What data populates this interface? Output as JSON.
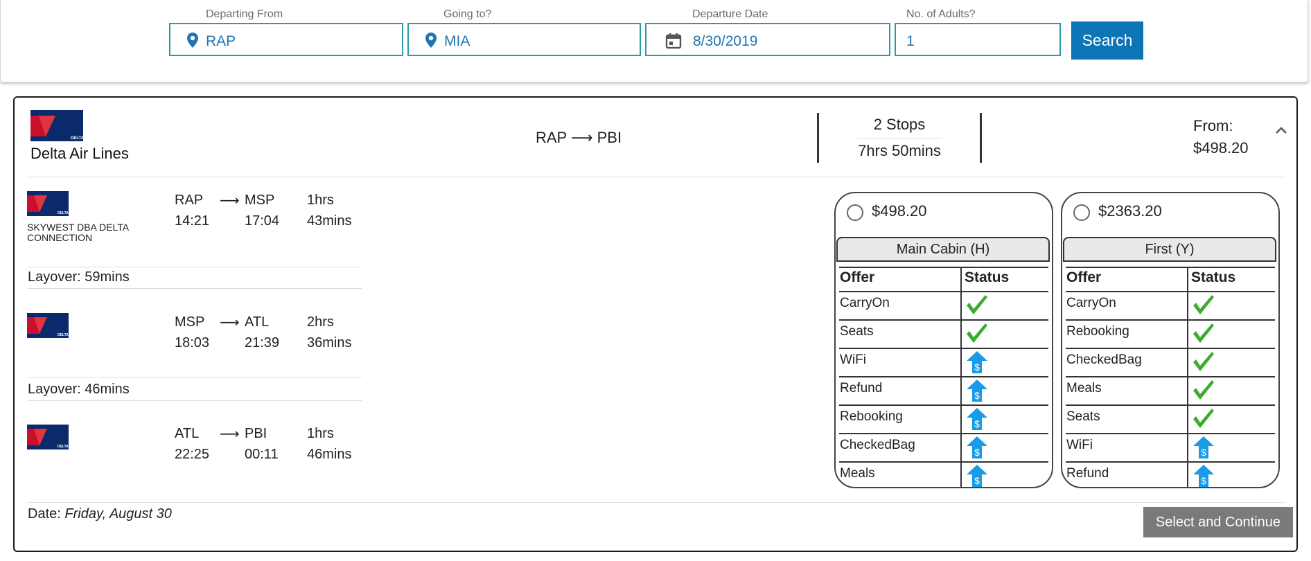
{
  "search": {
    "departing_label": "Departing From",
    "departing_value": "RAP",
    "going_label": "Going to?",
    "going_value": "MIA",
    "date_label": "Departure Date",
    "date_value": "8/30/2019",
    "adults_label": "No. of Adults?",
    "adults_value": "1",
    "search_button": "Search",
    "icons": [
      "location-pin-icon",
      "location-pin-icon",
      "calendar-icon"
    ]
  },
  "flight": {
    "airline": "Delta Air Lines",
    "route": "RAP ⟶ PBI",
    "stops": "2 Stops",
    "duration": "7hrs 50mins",
    "from_label": "From:",
    "from_price": "$498.20",
    "segments": [
      {
        "carrier": "SKYWEST DBA DELTA CONNECTION",
        "origin": "RAP",
        "arrow": "⟶",
        "destination": "MSP",
        "depart_time": "14:21",
        "arrive_time": "17:04",
        "dur_hrs": "1hrs",
        "dur_mins": "43mins"
      },
      {
        "carrier": "",
        "origin": "MSP",
        "arrow": "⟶",
        "destination": "ATL",
        "depart_time": "18:03",
        "arrive_time": "21:39",
        "dur_hrs": "2hrs",
        "dur_mins": "36mins"
      },
      {
        "carrier": "",
        "origin": "ATL",
        "arrow": "⟶",
        "destination": "PBI",
        "depart_time": "22:25",
        "arrive_time": "00:11",
        "dur_hrs": "1hrs",
        "dur_mins": "46mins"
      }
    ],
    "layovers": [
      "Layover: 59mins",
      "Layover: 46mins"
    ],
    "date_prefix": "Date:",
    "date_value": "Friday, August 30",
    "continue_button": "Select and Continue"
  },
  "fares": [
    {
      "price": "$498.20",
      "cabin": "Main Cabin  (H)",
      "offer_header": "Offer",
      "status_header": "Status",
      "offers": [
        {
          "name": "CarryOn",
          "status": "included"
        },
        {
          "name": "Seats",
          "status": "included"
        },
        {
          "name": "WiFi",
          "status": "paid-upgrade"
        },
        {
          "name": "Refund",
          "status": "paid-upgrade"
        },
        {
          "name": "Rebooking",
          "status": "paid-upgrade"
        },
        {
          "name": "CheckedBag",
          "status": "paid-upgrade"
        },
        {
          "name": "Meals",
          "status": "paid-upgrade"
        }
      ]
    },
    {
      "price": "$2363.20",
      "cabin": "First  (Y)",
      "offer_header": "Offer",
      "status_header": "Status",
      "offers": [
        {
          "name": "CarryOn",
          "status": "included"
        },
        {
          "name": "Rebooking",
          "status": "included"
        },
        {
          "name": "CheckedBag",
          "status": "included"
        },
        {
          "name": "Meals",
          "status": "included"
        },
        {
          "name": "Seats",
          "status": "included"
        },
        {
          "name": "WiFi",
          "status": "paid-upgrade"
        },
        {
          "name": "Refund",
          "status": "paid-upgrade"
        }
      ]
    }
  ],
  "colors": {
    "field_border": "#2a9aa6",
    "field_text": "#2174b3",
    "search_button": "#0d74b5",
    "check_green": "#3cac2e",
    "upgrade_blue": "#1a9be8",
    "delta_red": "#c8102e",
    "delta_navy": "#0b2a6b"
  }
}
